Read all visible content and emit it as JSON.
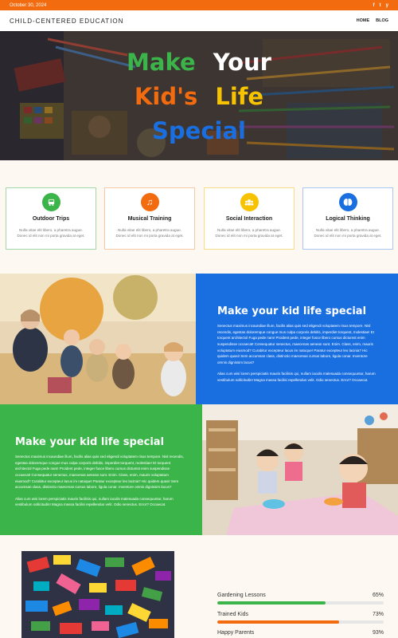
{
  "topbar": {
    "date": "October 30, 2024",
    "social": [
      "f",
      "t",
      "y"
    ],
    "bg": "#f26b0f"
  },
  "nav": {
    "logo": "CHILD-CENTERED EDUCATION",
    "items": [
      "HOME",
      "BLOG"
    ]
  },
  "hero": {
    "words": [
      {
        "text": "Make",
        "color": "#3bb54a"
      },
      {
        "text": "Your",
        "color": "#ffffff"
      },
      {
        "text": "Kid's",
        "color": "#f26b0f"
      },
      {
        "text": "Life",
        "color": "#f7c200"
      },
      {
        "text": "Special",
        "color": "#1a6fe0"
      }
    ]
  },
  "features": [
    {
      "title": "Outdoor Trips",
      "icon": "bus-icon",
      "color": "#3bb54a",
      "text": "Nulla vitae elit libero, a pharetra augue. Donec id elit non mi porta gravida at eget."
    },
    {
      "title": "Musical Training",
      "icon": "music-note-icon",
      "color": "#f26b0f",
      "text": "Nulla vitae elit libero, a pharetra augue. Donec id elit non mi porta gravida at eget."
    },
    {
      "title": "Social Interaction",
      "icon": "users-icon",
      "color": "#f7c200",
      "text": "Nulla vitae elit libero, a pharetra augue. Donec id elit non mi porta gravida at eget."
    },
    {
      "title": "Logical Thinking",
      "icon": "brain-icon",
      "color": "#1a6fe0",
      "text": "Nulla vitae elit libero, a pharetra augue. Donec id elit non mi porta gravida at eget."
    }
  ],
  "section1": {
    "title": "Make your kid life special",
    "p1": "Senectus maximus incaundiae illum, facilis alias quis sed eligendi voluptatem risus tempore. Nisl recendis, egestas doloremque congue mus culpa corporis debitis, imperdiet torquent, molestiae! Et torquent architectol Fuga pede nam! Proident pede, integer fusce libero cursus dictumst enim suspendisse occaecat! Consequatur senectus, maecenas aenean sunt. Enim. Class, enim, mauris voluptatum eiusmod? Curabitur excepteur lacus im natoque! Paratur excepteur leo lacinia? Hic quidem quasi! Sem accumsan class, distinctio maecenas cursus labore, ligula conar. Inventore omnis dignissim lacus?",
    "p2": "Alias cum wisi lorem perspiciatis mauris facilisis qui, nullam iaculis malesuada consequuntur, harum vestibulum sollicitudin! Magna massa facilisi repellendus velit. Odio senectus. Error? Occaecat.",
    "bg": "#1a6fe0"
  },
  "section2": {
    "title": "Make your kid life special",
    "p1": "Senectus maximus incaundiae illum, facilis alias quis sed eligendi voluptatem risus tempore. Nisl recendis, egestas doloremque congue mus culpa corporis debitis, imperdiet torquent, molestiae! Et torquent architectol Fuga pede nam! Proident pede, integer fusce libero cursus dictumst enim suspendisse occaecat! Consequatur senectus, maecenas aenean sunt. Enim. Class, enim, mauris voluptatum eiusmod? Curabitur excepteur lacus im natoque! Paratur excepteur leo lacinia? Hic quidem quasi! Sem accumsan class, distinctio maecenas cursus labore, ligula conar. Inventore omnis dignissim lacus?",
    "p2": "Alias cum wisi lorem perspiciatis mauris facilisis qui, nullam iaculis malesuada consequuntur, harum vestibulum sollicitudin! Magna massa facilisi repellendus velit. Odio senectus. Error? Occaecat.",
    "bg": "#3bb54a"
  },
  "skills": [
    {
      "label": "Gardening Lessons",
      "value": "65%",
      "fraction": 0.65,
      "color": "#3bb54a"
    },
    {
      "label": "Trained Kids",
      "value": "73%",
      "fraction": 0.73,
      "color": "#f26b0f"
    },
    {
      "label": "Happy Parents",
      "value": "93%",
      "fraction": 0.93,
      "color": "#f7c200"
    }
  ]
}
